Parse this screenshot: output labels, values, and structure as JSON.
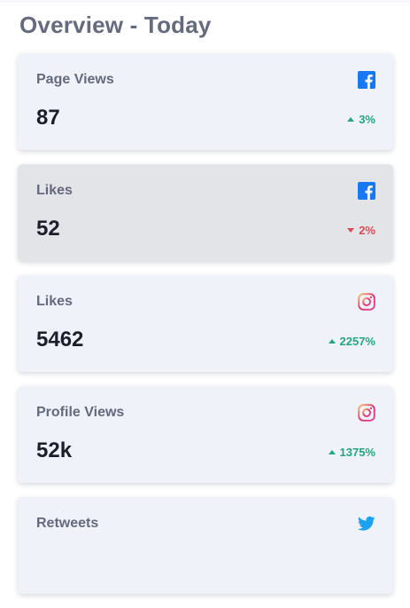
{
  "header": {
    "title": "Overview - Today"
  },
  "colors": {
    "positive": "#22a77c",
    "negative": "#d94a55",
    "facebook": "#1778f2",
    "twitter": "#1da1f2"
  },
  "cards": [
    {
      "label": "Page Views",
      "value": "87",
      "change": "3%",
      "direction": "up",
      "icon": "facebook-icon"
    },
    {
      "label": "Likes",
      "value": "52",
      "change": "2%",
      "direction": "down",
      "icon": "facebook-icon"
    },
    {
      "label": "Likes",
      "value": "5462",
      "change": "2257%",
      "direction": "up",
      "icon": "instagram-icon"
    },
    {
      "label": "Profile Views",
      "value": "52k",
      "change": "1375%",
      "direction": "up",
      "icon": "instagram-icon"
    },
    {
      "label": "Retweets",
      "icon": "twitter-icon"
    }
  ]
}
